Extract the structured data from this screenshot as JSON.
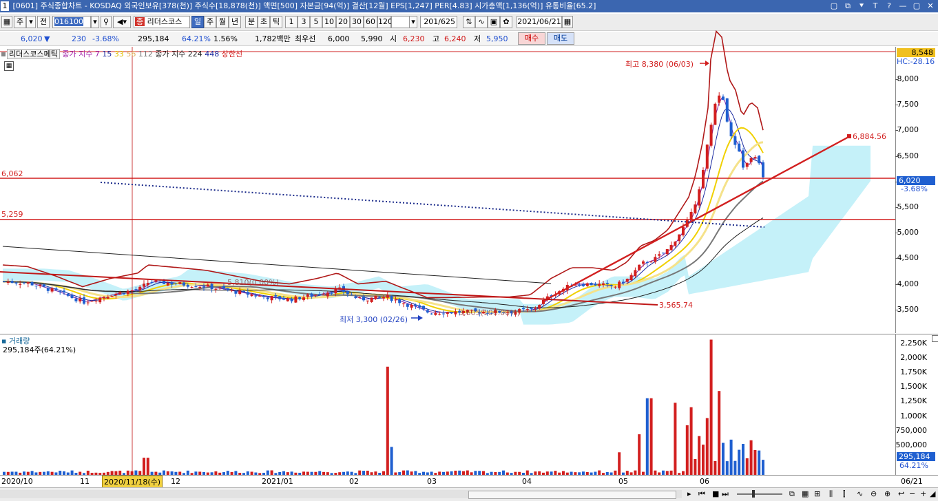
{
  "titlebar": {
    "window_number": "1",
    "text": "[0601] 주식종합차트 - KOSDAQ 외국인보유[378(천)] 주식수[18,878(천)] 액면[500] 자본금[94(억)] 결산[12월] EPS[1,247] PER[4.83] 시가총액[1,136(억)] 유통비율[65.2]",
    "buttons": [
      "▢",
      "⧉",
      "⯆",
      "T",
      "?",
      "—",
      "▢",
      "✕"
    ]
  },
  "toolbar": {
    "market": "주",
    "prev_label": "전",
    "code": "016100",
    "name": "리더스코스",
    "name_badge": "종",
    "periods": [
      "일",
      "주",
      "월",
      "년",
      "분",
      "초",
      "틱"
    ],
    "intervals": [
      "1",
      "3",
      "5",
      "10",
      "20",
      "30",
      "60",
      "120"
    ],
    "count": "201",
    "count_total": "/625",
    "date": "2021/06/21"
  },
  "quote": {
    "price": "6,020",
    "change": "230",
    "change_pct": "-3.68%",
    "volume": "295,184",
    "vol_ratio": "64.21%",
    "turnover": "1.56%",
    "amount": "1,782백만",
    "ask_label": "최우선",
    "ask": "6,000",
    "bid": "5,990",
    "open_label": "시",
    "open": "6,230",
    "high_label": "고",
    "high": "6,240",
    "low_label": "저",
    "low": "5,950",
    "buy_label": "매수",
    "sell_label": "매도"
  },
  "legend": {
    "name": "리더스코스메틱",
    "ma_short": "종가 지수 7",
    "ma_vals": [
      "15",
      "33",
      "56",
      "112"
    ],
    "ma_long": "종가 지수 224",
    "ma_long2": "448",
    "cloud": "상한선"
  },
  "annotations": {
    "high": "최고 8,380 (06/03)",
    "low": "최저 3,300 (02/26)",
    "trend_value": "6,884.56",
    "support_value": "3,565.74",
    "hline1": "6,062",
    "hline2": "5,259",
    "cursor_date": "2020/11/18(수)",
    "faint1": "5,810(0.00%)",
    "faint2": "3,605(100.00%)"
  },
  "price_axis": {
    "top_box": "8,548",
    "hc_label": "HC:-28.16",
    "ticks": [
      "8,000",
      "7,500",
      "7,000",
      "6,500",
      "6,000",
      "5,500",
      "5,000",
      "4,500",
      "4,000",
      "3,500"
    ],
    "current": "6,020",
    "current_pct": "-3.68%"
  },
  "volume": {
    "title": "거래량",
    "value": "295,184주(64.21%)",
    "ticks": [
      "2,250K",
      "2,000K",
      "1,750K",
      "1,500K",
      "1,250K",
      "1,000K",
      "750,000",
      "500,000"
    ],
    "current": "295,184",
    "current_pct": "64.21%"
  },
  "x_axis": {
    "labels": [
      "2020/10",
      "11",
      "12",
      "2021/01",
      "02",
      "03",
      "04",
      "05",
      "06"
    ],
    "right_label": "06/21"
  },
  "colors": {
    "up": "#d21f1f",
    "down": "#1f5fd0",
    "ma7": "#7a1fa8",
    "ma15": "#1a2aa0",
    "ma33": "#f0d000",
    "ma56": "#f5e28a",
    "ma112": "#777777",
    "ma224": "#222222",
    "cloud": "#bff0f8",
    "title_bg": "#3b66b0"
  }
}
